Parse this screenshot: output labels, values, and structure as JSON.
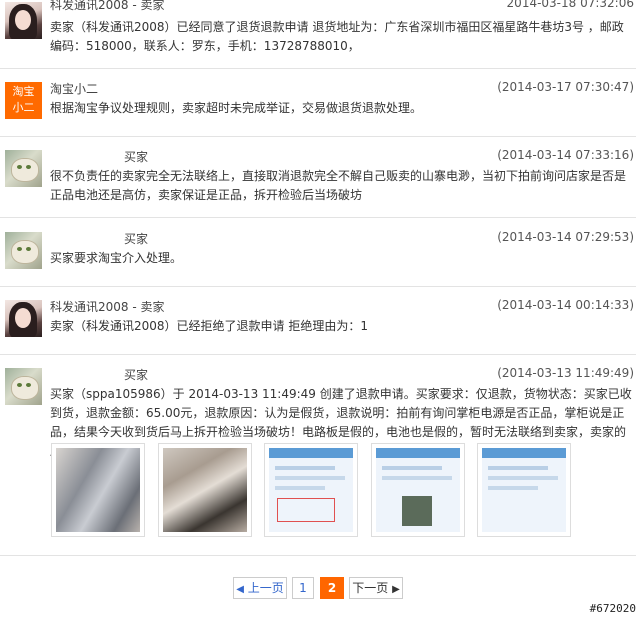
{
  "entries": [
    {
      "name": "科发通讯2008 - 卖家",
      "date": "2014-03-18 07:32:06",
      "body": "卖家（科发通讯2008）已经同意了退货退款申请 退货地址为：广东省深圳市福田区福星路牛巷坊3号 ，邮政编码：518000，联系人：罗东，手机：13728788010，"
    },
    {
      "name": "淘宝小二",
      "date": "(2014-03-17 07:30:47)",
      "avatar_text": "淘宝\n小二",
      "body": "根据淘宝争议处理规则，卖家超时未完成举证，交易做退货退款处理。"
    },
    {
      "name": "买家",
      "date": "(2014-03-14 07:33:16)",
      "body": "很不负责任的卖家完全无法联络上，直接取消退款完全不解自己贩卖的山寨电渺，当初下拍前询问店家是否是正品电池还是高仿，卖家保证是正品，拆开检验后当场破坊"
    },
    {
      "name": "买家",
      "date": "(2014-03-14 07:29:53)",
      "body": "买家要求淘宝介入处理。"
    },
    {
      "name": "科发通讯2008 - 卖家",
      "date": "(2014-03-14 00:14:33)",
      "body": "卖家（科发通讯2008）已经拒绝了退款申请 拒绝理由为：1"
    },
    {
      "name": "买家",
      "date": "(2014-03-13 11:49:49)",
      "body": "买家（sppa105986）于 2014-03-13 11:49:49 创建了退款申请。买家要求：仅退款，货物状态：买家已收到货，退款金额：65.00元，退款原因：认为是假货，退款说明：拍前有询问掌柜电源是否正品，掌柜说是正品，结果今天收到货后马上拆开检验当场破坊！电路板是假的，电池也是假的，暂时无法联络到卖家，卖家的店铺也下架...."
    }
  ],
  "pagination": {
    "prev": "上一页",
    "page1": "1",
    "page2": "2",
    "next": "下一页"
  },
  "watermark": "#672020",
  "colors": {
    "accent": "#ff6600",
    "taobao": "#ff6a00",
    "link": "#3366cc"
  }
}
